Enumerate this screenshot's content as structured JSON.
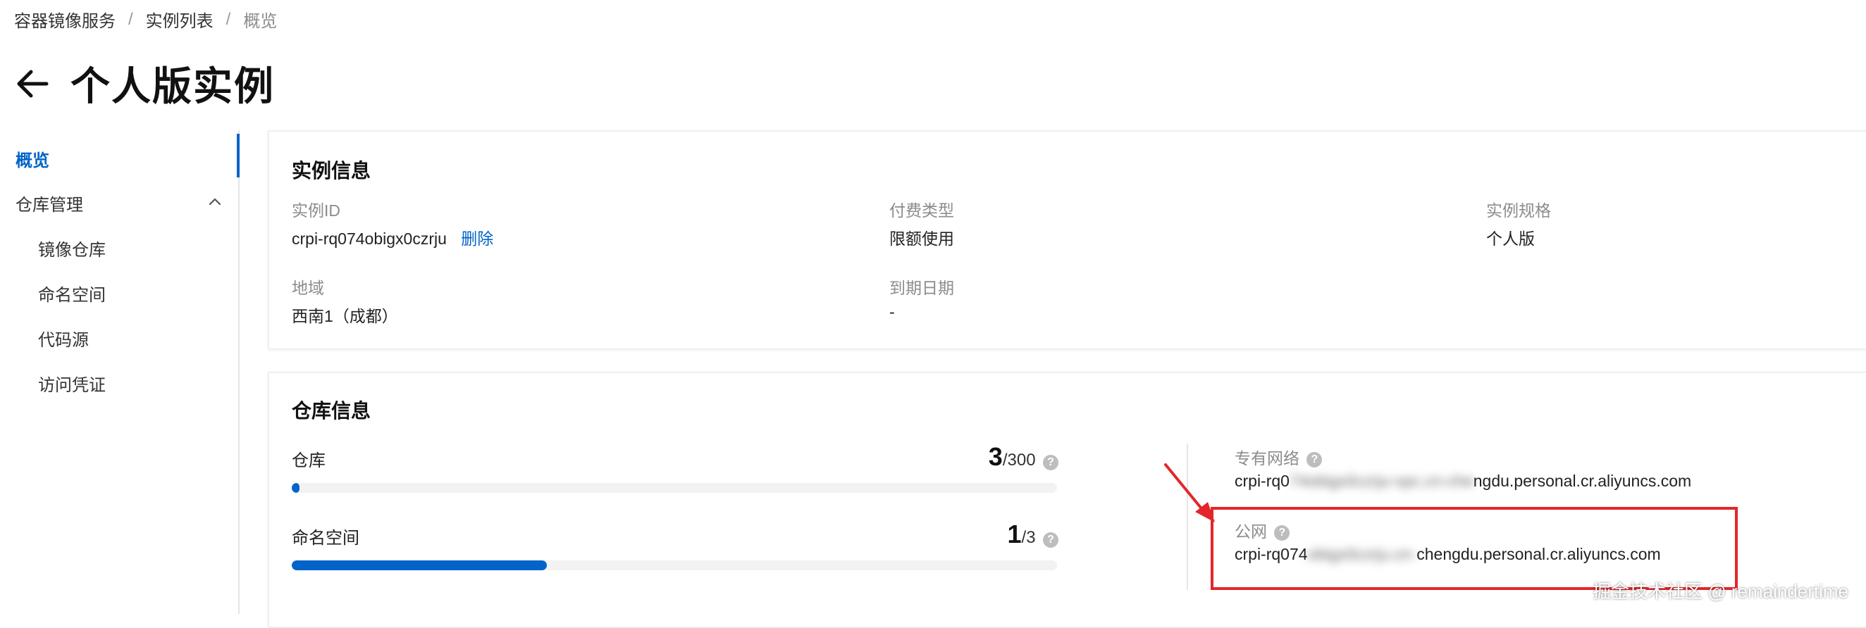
{
  "breadcrumb": {
    "items": [
      "容器镜像服务",
      "实例列表"
    ],
    "current": "概览",
    "separator": "/"
  },
  "page": {
    "title": "个人版实例"
  },
  "sidebar": {
    "items": [
      {
        "label": "概览"
      },
      {
        "label": "仓库管理"
      },
      {
        "label": "镜像仓库"
      },
      {
        "label": "命名空间"
      },
      {
        "label": "代码源"
      },
      {
        "label": "访问凭证"
      }
    ]
  },
  "instance_info": {
    "title": "实例信息",
    "instance_id_label": "实例ID",
    "instance_id_value": "crpi-rq074obigx0czrju",
    "delete_label": "删除",
    "billing_label": "付费类型",
    "billing_value": "限额使用",
    "spec_label": "实例规格",
    "spec_value": "个人版",
    "region_label": "地域",
    "region_value": "西南1（成都）",
    "expire_label": "到期日期",
    "expire_value": "-"
  },
  "repo_info": {
    "title": "仓库信息",
    "repo_label": "仓库",
    "repo_used": "3",
    "repo_total": "/300",
    "repo_progress_percent": 1,
    "ns_label": "命名空间",
    "ns_used": "1",
    "ns_total": "/3",
    "ns_progress_percent": 33.3,
    "vpc_label": "专有网络",
    "vpc_prefix": "crpi-rq0",
    "vpc_blur": "74obigx0czrju-vpc.cn-che",
    "vpc_suffix": "ngdu.personal.cr.aliyuncs.com",
    "public_label": "公网",
    "public_prefix": "crpi-rq074",
    "public_blur": "obigx0czrju.cn-",
    "public_suffix": "chengdu.personal.cr.aliyuncs.com",
    "help_glyph": "?"
  },
  "watermark": "掘金技术社区 @ remaindertime",
  "colors": {
    "accent": "#0064c8",
    "annotation_red": "#e3262b"
  }
}
